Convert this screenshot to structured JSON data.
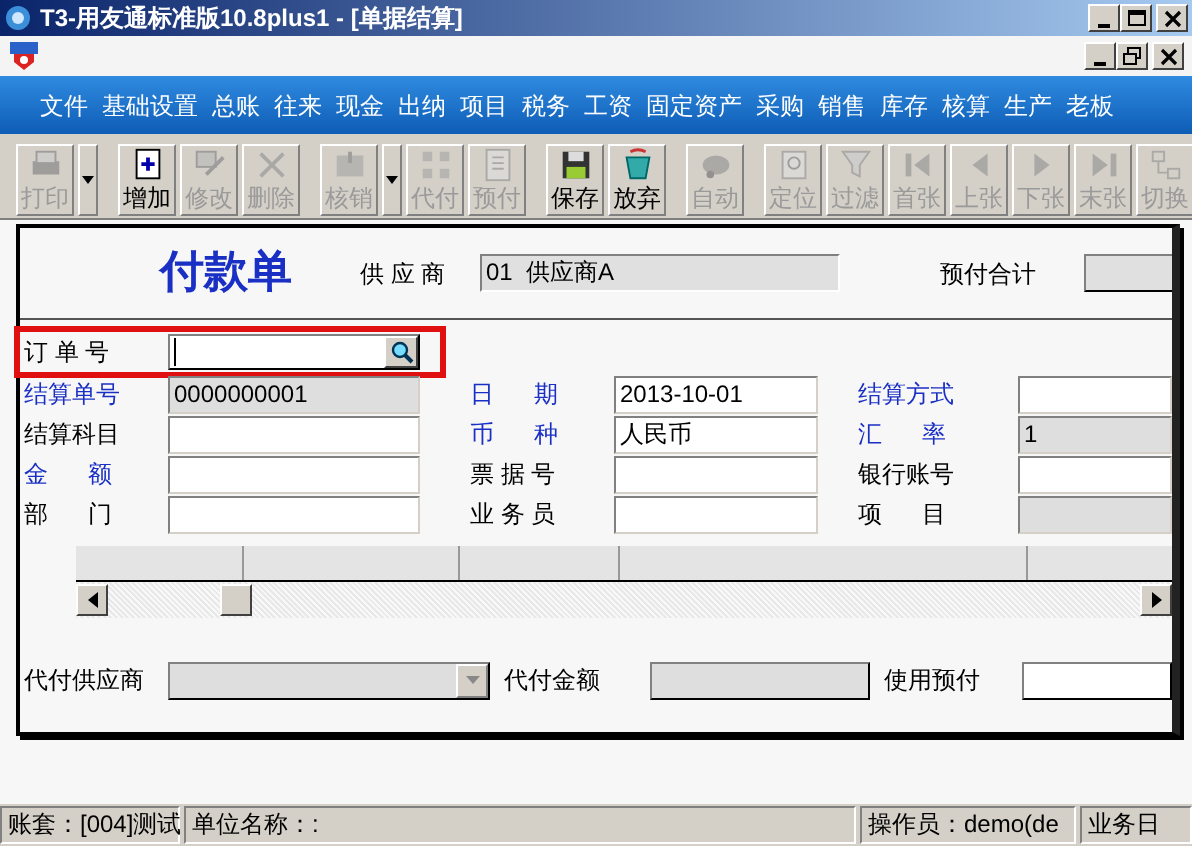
{
  "window": {
    "title": "T3-用友通标准版10.8plus1 - [单据结算]"
  },
  "menu": [
    "文件",
    "基础设置",
    "总账",
    "往来",
    "现金",
    "出纳",
    "项目",
    "税务",
    "工资",
    "固定资产",
    "采购",
    "销售",
    "库存",
    "核算",
    "生产",
    "老板"
  ],
  "toolbar": {
    "groups": [
      [
        {
          "kind": "button",
          "label": "打印",
          "disabled": true
        },
        {
          "kind": "arrow",
          "disabled": false
        }
      ],
      [
        {
          "kind": "button",
          "label": "增加",
          "disabled": false
        },
        {
          "kind": "button",
          "label": "修改",
          "disabled": true
        },
        {
          "kind": "button",
          "label": "删除",
          "disabled": true
        }
      ],
      [
        {
          "kind": "button",
          "label": "核销",
          "disabled": true
        },
        {
          "kind": "arrow",
          "disabled": false
        },
        {
          "kind": "button",
          "label": "代付",
          "disabled": true
        },
        {
          "kind": "button",
          "label": "预付",
          "disabled": true
        }
      ],
      [
        {
          "kind": "button",
          "label": "保存",
          "disabled": false
        },
        {
          "kind": "button",
          "label": "放弃",
          "disabled": false
        }
      ],
      [
        {
          "kind": "button",
          "label": "自动",
          "disabled": true
        }
      ],
      [
        {
          "kind": "button",
          "label": "定位",
          "disabled": true
        },
        {
          "kind": "button",
          "label": "过滤",
          "disabled": true
        },
        {
          "kind": "button",
          "label": "首张",
          "disabled": true
        },
        {
          "kind": "button",
          "label": "上张",
          "disabled": true
        },
        {
          "kind": "button",
          "label": "下张",
          "disabled": true
        },
        {
          "kind": "button",
          "label": "末张",
          "disabled": true
        },
        {
          "kind": "button",
          "label": "切换",
          "disabled": true
        }
      ]
    ]
  },
  "form": {
    "title": "付款单",
    "supplier": {
      "label": "供 应 商",
      "value": "01  供应商A"
    },
    "prepay_total": {
      "label": "预付合计"
    },
    "order_no": {
      "label": "订 单 号",
      "highlighted": true
    },
    "rows": [
      [
        {
          "label": "结算单号",
          "value": "0000000001",
          "required": true,
          "disabled": true
        },
        {
          "label": "日      期",
          "value": "2013-10-01",
          "required": true,
          "disabled": false
        },
        {
          "label": "结算方式",
          "required": true,
          "disabled": false
        }
      ],
      [
        {
          "label": "结算科目",
          "required": false,
          "disabled": false
        },
        {
          "label": "币      种",
          "value": "人民币",
          "required": true,
          "disabled": false
        },
        {
          "label": "汇      率",
          "value": "1",
          "required": true,
          "disabled": true
        }
      ],
      [
        {
          "label": "金      额",
          "required": true,
          "disabled": false
        },
        {
          "label": "票 据 号",
          "required": false,
          "disabled": false
        },
        {
          "label": "银行账号",
          "required": false,
          "disabled": false
        }
      ],
      [
        {
          "label": "部      门",
          "required": false,
          "disabled": false
        },
        {
          "label": "业 务 员",
          "required": false,
          "disabled": false
        },
        {
          "label": "项      目",
          "required": false,
          "disabled": true
        }
      ]
    ],
    "footer": {
      "agent_supplier": {
        "label": "代付供应商"
      },
      "agent_amount": {
        "label": "代付金额"
      },
      "use_prepay": {
        "label": "使用预付"
      }
    }
  },
  "status_bar": [
    "账套：[004]测试",
    "单位名称：:",
    "操作员：demo(de",
    "业务日"
  ]
}
